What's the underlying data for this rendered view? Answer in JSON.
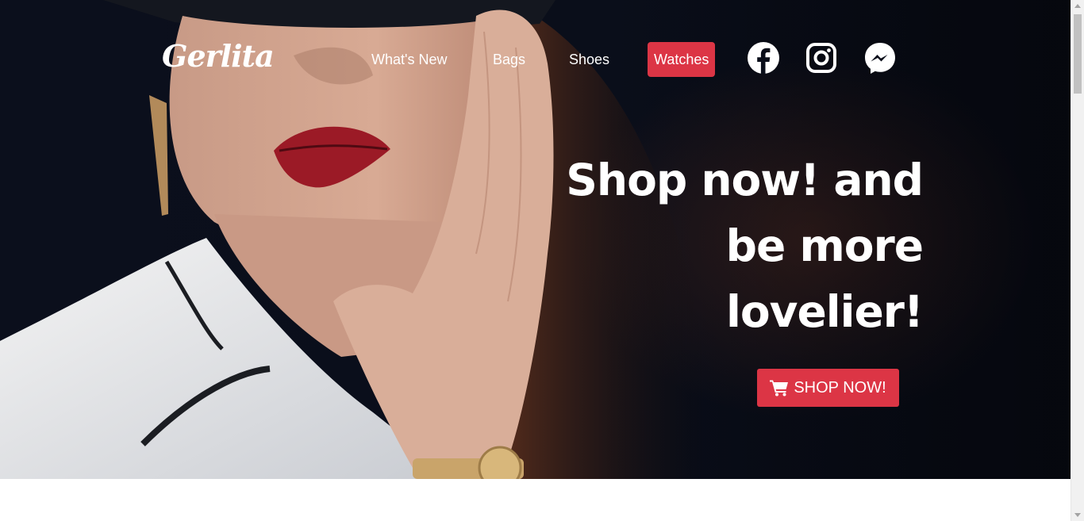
{
  "brand": {
    "logo_text": "Gerlita"
  },
  "nav": {
    "items": [
      {
        "label": "What's New",
        "active": false
      },
      {
        "label": "Bags",
        "active": false
      },
      {
        "label": "Shoes",
        "active": false
      },
      {
        "label": "Watches",
        "active": true
      }
    ],
    "social_icons": [
      "facebook-icon",
      "instagram-icon",
      "messenger-icon"
    ]
  },
  "hero": {
    "headline_lines": [
      "Shop now! and",
      "be more",
      "lovelier!"
    ],
    "cta_label": "SHOP NOW!",
    "cta_icon": "shopping-cart-icon"
  },
  "colors": {
    "accent": "#dc3545",
    "hero_background": "#0a0e1a",
    "text_on_dark": "#ffffff"
  }
}
